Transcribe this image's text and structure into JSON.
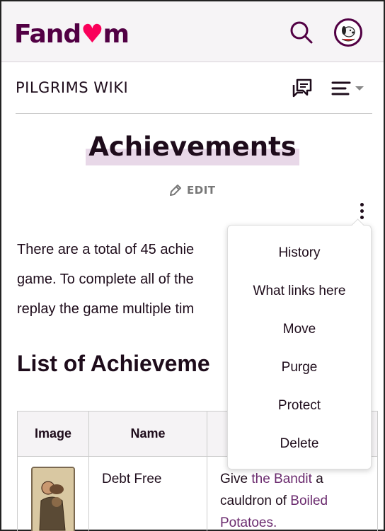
{
  "header": {
    "logo_text_start": "Fand",
    "logo_text_heart": "♥",
    "logo_text_end": "m",
    "search_icon": "search-icon",
    "avatar_icon": "user-avatar"
  },
  "wiki": {
    "name": "PILGRIMS WIKI",
    "discuss_icon": "discussions-icon",
    "menu_icon": "menu-icon"
  },
  "page": {
    "title": "Achievements",
    "edit_label": "EDIT",
    "intro_lines": [
      "There are a total of 45 achie",
      "game. To complete all of the",
      "replay the game multiple tim"
    ],
    "section_heading": "List of Achieveme"
  },
  "table": {
    "headers": [
      "Image",
      "Name",
      ""
    ],
    "rows": [
      {
        "name": "Debt Free",
        "desc_parts": [
          {
            "text": "Give ",
            "link": false
          },
          {
            "text": "the Bandit",
            "link": true
          },
          {
            "text": " a cauldron of ",
            "link": false
          },
          {
            "text": "Boiled Potatoes",
            "link": true
          },
          {
            "text": ".",
            "link": true
          }
        ]
      }
    ]
  },
  "dropdown": {
    "items": [
      "History",
      "What links here",
      "Move",
      "Purge",
      "Protect",
      "Delete"
    ]
  },
  "colors": {
    "brand": "#520044",
    "accent": "#fa005a",
    "link": "#6a2a6e"
  }
}
